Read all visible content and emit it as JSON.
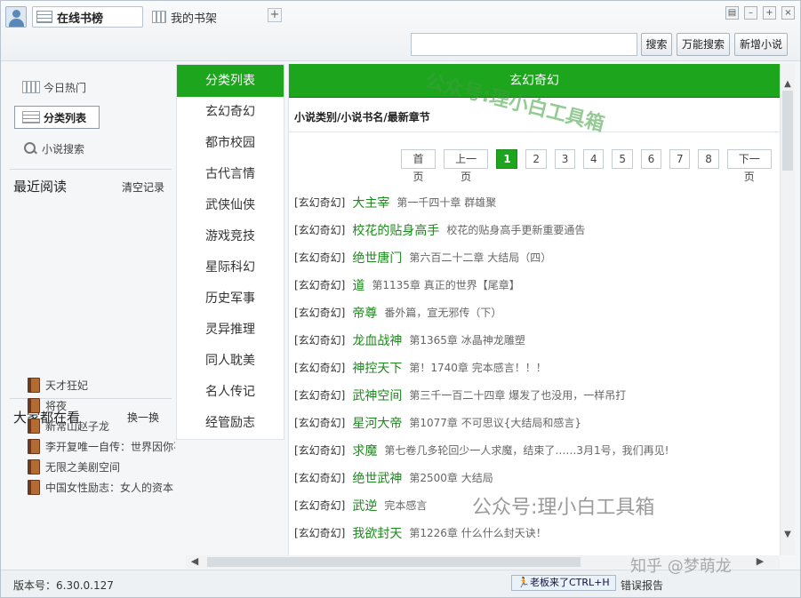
{
  "window": {
    "tabs": [
      {
        "label": "在线书榜",
        "active": true
      },
      {
        "label": "我的书架",
        "active": false
      }
    ],
    "add_tab_label": "+",
    "controls": [
      "▤",
      "–",
      "+",
      "×"
    ]
  },
  "search": {
    "value": "",
    "buttons": {
      "search": "搜索",
      "universal": "万能搜索",
      "add_novel": "新增小说"
    }
  },
  "sidebar": {
    "nav": [
      {
        "label": "今日热门",
        "icon": "bars-icon"
      },
      {
        "label": "分类列表",
        "icon": "list-icon",
        "active": true
      },
      {
        "label": "小说搜索",
        "icon": "search-icon"
      }
    ],
    "recent": {
      "title": "最近阅读",
      "clear_label": "清空记录"
    },
    "popular": {
      "title": "大家都在看",
      "refresh_label": "换一换",
      "items": [
        "天才狂妃",
        "将夜",
        "新常山赵子龙",
        "李开复唯一自传：世界因你不",
        "无限之美剧空间",
        "中国女性励志：女人的资本"
      ]
    }
  },
  "categories": {
    "header": "分类列表",
    "items": [
      "玄幻奇幻",
      "都市校园",
      "古代言情",
      "武侠仙侠",
      "游戏竞技",
      "星际科幻",
      "历史军事",
      "灵异推理",
      "同人耽美",
      "名人传记",
      "经管励志"
    ]
  },
  "main": {
    "header": "玄幻奇幻",
    "breadcrumb": "小说类别/小说书名/最新章节",
    "pager": {
      "first": "首页",
      "prev": "上一页",
      "pages": [
        "1",
        "2",
        "3",
        "4",
        "5",
        "6",
        "7",
        "8"
      ],
      "current": "1",
      "next": "下一页"
    },
    "rows": [
      {
        "cat": "[玄幻奇幻]",
        "title": "大主宰",
        "chapter": "第一千四十章 群雄聚"
      },
      {
        "cat": "[玄幻奇幻]",
        "title": "校花的贴身高手",
        "chapter": "校花的贴身高手更新重要通告"
      },
      {
        "cat": "[玄幻奇幻]",
        "title": "绝世唐门",
        "chapter": "第六百二十二章 大结局（四）"
      },
      {
        "cat": "[玄幻奇幻]",
        "title": "道",
        "chapter": "第1135章 真正的世界【尾章】"
      },
      {
        "cat": "[玄幻奇幻]",
        "title": "帝尊",
        "chapter": "番外篇，宣无邪传（下）"
      },
      {
        "cat": "[玄幻奇幻]",
        "title": "龙血战神",
        "chapter": "第1365章 冰晶神龙雕塑"
      },
      {
        "cat": "[玄幻奇幻]",
        "title": "神控天下",
        "chapter": "第！1740章 完本感言！！！"
      },
      {
        "cat": "[玄幻奇幻]",
        "title": "武神空间",
        "chapter": "第三千一百二十四章 爆发了也没用，一样吊打"
      },
      {
        "cat": "[玄幻奇幻]",
        "title": "星河大帝",
        "chapter": "第1077章 不可思议{大结局和感言}"
      },
      {
        "cat": "[玄幻奇幻]",
        "title": "求魔",
        "chapter": "第七卷几多轮回少一人求魔，结束了……3月1号，我们再见!"
      },
      {
        "cat": "[玄幻奇幻]",
        "title": "绝世武神",
        "chapter": "第2500章 大结局"
      },
      {
        "cat": "[玄幻奇幻]",
        "title": "武逆",
        "chapter": "完本感言"
      },
      {
        "cat": "[玄幻奇幻]",
        "title": "我欲封天",
        "chapter": "第1226章 什么什么封天诀！"
      }
    ]
  },
  "status": {
    "version": "版本号：6.30.0.127",
    "boss_key": "老板来了CTRL+H",
    "report": "错误报告"
  },
  "watermarks": {
    "top": "公众号:理小白工具箱",
    "mid": "公众号:理小白工具箱",
    "corner": "知乎 @梦萌龙"
  },
  "colors": {
    "accent_green": "#1ea51e",
    "title_green": "#1a8a1a"
  }
}
